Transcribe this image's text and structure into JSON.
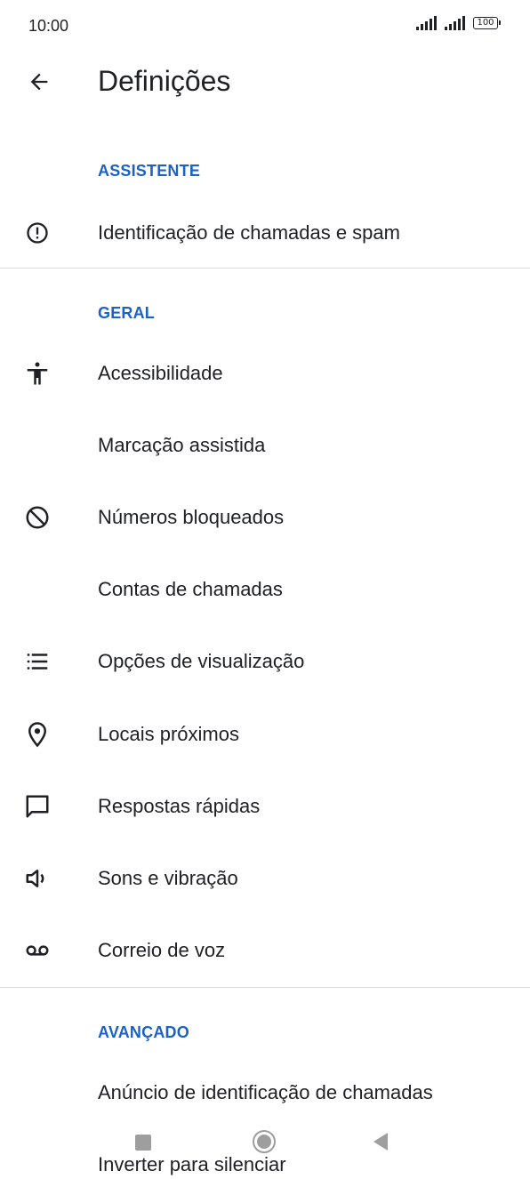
{
  "status_bar": {
    "time": "10:00",
    "battery": "100",
    "icons": [
      "signal-icon",
      "signal-icon",
      "battery-icon"
    ]
  },
  "app_bar": {
    "title": "Definições",
    "back_icon": "arrow-back-icon"
  },
  "sections": {
    "assistant": {
      "header": "ASSISTENTE",
      "items": [
        {
          "label": "Identificação de chamadas e spam",
          "icon": "alert-circle-icon"
        }
      ]
    },
    "general": {
      "header": "GERAL",
      "items": [
        {
          "label": "Acessibilidade",
          "icon": "accessibility-icon"
        },
        {
          "label": "Marcação assistida",
          "icon": ""
        },
        {
          "label": "Números bloqueados",
          "icon": "block-icon"
        },
        {
          "label": "Contas de chamadas",
          "icon": ""
        },
        {
          "label": "Opções de visualização",
          "icon": "list-icon"
        },
        {
          "label": "Locais próximos",
          "icon": "location-pin-icon"
        },
        {
          "label": "Respostas rápidas",
          "icon": "message-icon"
        },
        {
          "label": "Sons e vibração",
          "icon": "volume-icon"
        },
        {
          "label": "Correio de voz",
          "icon": "voicemail-icon"
        }
      ]
    },
    "advanced": {
      "header": "AVANÇADO",
      "items": [
        {
          "label": "Anúncio de identificação de chamadas",
          "icon": ""
        },
        {
          "label": "Inverter para silenciar",
          "icon": ""
        }
      ]
    }
  },
  "nav_bar": {
    "icons": [
      "recents-square-icon",
      "home-circle-icon",
      "back-triangle-icon"
    ]
  },
  "colors": {
    "accent": "#1a62c6",
    "text": "#202124",
    "divider": "#dadce0",
    "nav": "#9e9e9e"
  }
}
